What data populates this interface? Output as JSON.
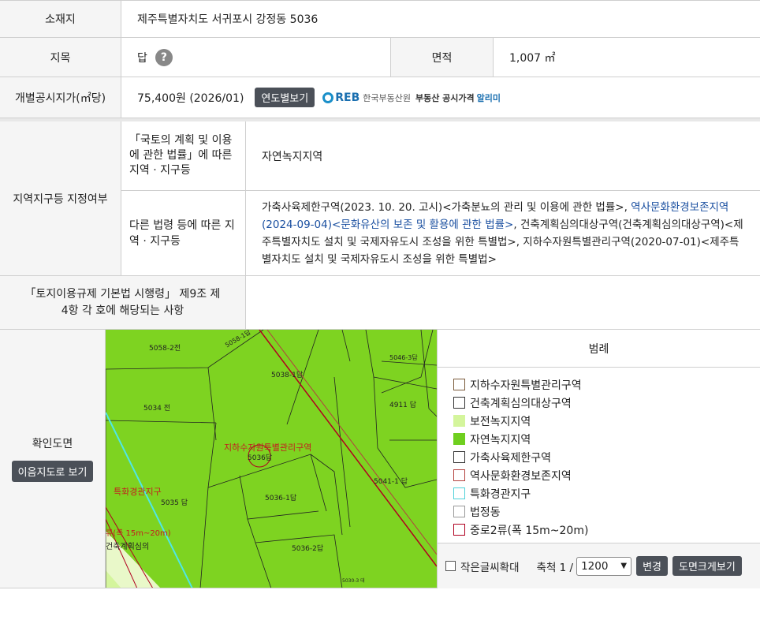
{
  "location": {
    "label": "소재지",
    "value": "제주특별자치도 서귀포시 강정동 5036"
  },
  "land_category": {
    "label": "지목",
    "value": "답",
    "help_icon": "?"
  },
  "area": {
    "label": "면적",
    "value": "1,007 ㎡"
  },
  "official_price": {
    "label": "개별공시지가(㎡당)",
    "value": "75,400원 (2026/01)",
    "button": "연도별보기",
    "logo_text": "한국부동산원",
    "logo_link": "부동산 공시가격",
    "logo_link2": "알리미"
  },
  "zoning": {
    "label": "지역지구등 지정여부",
    "row1_header": "「국토의 계획 및 이용에 관한 법률」에 따른 지역 · 지구등",
    "row1_value": "자연녹지지역",
    "row2_header": "다른 법령 등에 따른 지역 · 지구등",
    "row2_a": "가축사육제한구역(2023. 10. 20. 고시)<가축분뇨의 관리 및 이용에 관한 법률>, ",
    "row2_link": "역사문화환경보존지역(2024-09-04)<문화유산의 보존 및 활용에 관한 법률>",
    "row2_b": ", 건축계획심의대상구역(건축계획심의대상구역)<제주특별자치도 설치 및 국제자유도시 조성을 위한 특별법>, 지하수자원특별관리구역(2020-07-01)<제주특별자치도 설치 및 국제자유도시 조성을 위한 특별법>"
  },
  "regulation": {
    "label": "「토지이용규제 기본법 시행령」 제9조 제4항 각 호에 해당되는 사항",
    "value": ""
  },
  "map": {
    "label": "확인도면",
    "button": "이음지도로 보기",
    "parcels": [
      "5058-2전",
      "5058-1답",
      "5038-1답",
      "5046-3답",
      "4911 답",
      "5034 전",
      "5036답",
      "5041-1 답",
      "5035 답",
      "5036-1답",
      "5036-2답",
      "5030-3 대"
    ],
    "overlay_labels": [
      "지하수자원특별관리구역",
      "특화경관지구",
      "류(폭 15m~20m)",
      "건축계획심의"
    ],
    "land_color": "#7ed321"
  },
  "legend": {
    "title": "범례",
    "items": [
      {
        "label": "지하수자원특별관리구역",
        "color": "#ffffff",
        "border": "#7a5a3a"
      },
      {
        "label": "건축계획심의대상구역",
        "color": "#ffffff",
        "border": "#333333"
      },
      {
        "label": "보전녹지지역",
        "color": "#d4f59c",
        "border": "#d4f59c"
      },
      {
        "label": "자연녹지지역",
        "color": "#6fcf1f",
        "border": "#6fcf1f"
      },
      {
        "label": "가축사육제한구역",
        "color": "#ffffff",
        "border": "#333333"
      },
      {
        "label": "역사문화환경보존지역",
        "color": "#ffffff",
        "border": "#b3413e"
      },
      {
        "label": "특화경관지구",
        "color": "#ffffff",
        "border": "#4fd1d9"
      },
      {
        "label": "법정동",
        "color": "#ffffff",
        "border": "#cccccc"
      },
      {
        "label": "중로2류(폭 15m~20m)",
        "color": "#ffffff",
        "border": "#b00020"
      }
    ]
  },
  "controls": {
    "small_text_label": "작은글씨확대",
    "scale_label": "축척 1 /",
    "scale_value": "1200",
    "change_button": "변경",
    "large_view_button": "도면크게보기"
  }
}
